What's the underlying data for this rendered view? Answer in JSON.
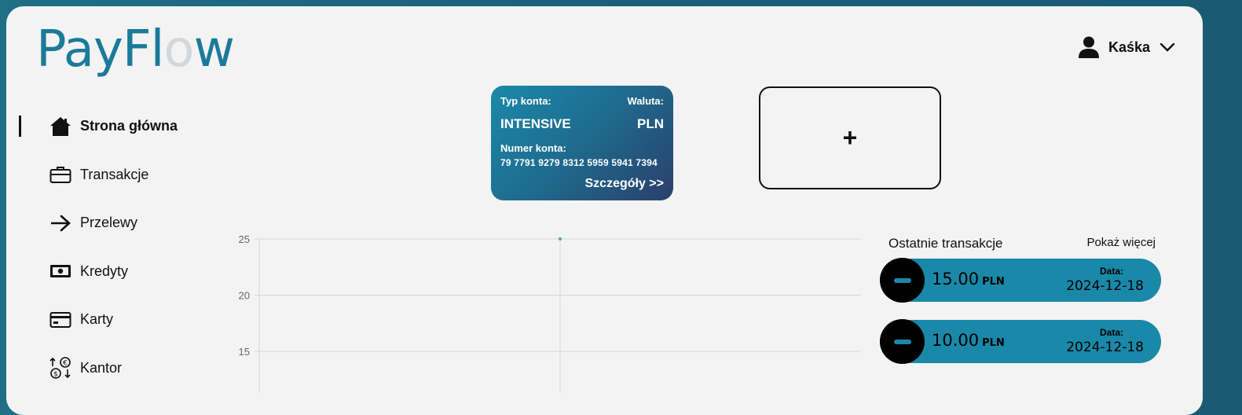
{
  "brand": {
    "name_prefix": "PayFl",
    "name_o": "o",
    "name_suffix": "w"
  },
  "user": {
    "name": "Kaśka"
  },
  "nav": [
    {
      "label": "Strona główna",
      "icon": "home-icon",
      "active": true
    },
    {
      "label": "Transakcje",
      "icon": "briefcase-icon",
      "active": false
    },
    {
      "label": "Przelewy",
      "icon": "arrow-right-icon",
      "active": false
    },
    {
      "label": "Kredyty",
      "icon": "cash-icon",
      "active": false
    },
    {
      "label": "Karty",
      "icon": "card-icon",
      "active": false
    },
    {
      "label": "Kantor",
      "icon": "exchange-icon",
      "active": false
    }
  ],
  "account": {
    "type_label": "Typ konta:",
    "type_value": "INTENSIVE",
    "currency_label": "Waluta:",
    "currency_value": "PLN",
    "number_label": "Numer konta:",
    "number_value": "79 7791 9279 8312 5959 5941 7394",
    "details_label": "Szczegóły >>"
  },
  "add_account": {
    "label": "+"
  },
  "chart_data": {
    "type": "line",
    "y_ticks": [
      "25",
      "20",
      "15"
    ],
    "ylim": [
      10,
      25
    ],
    "x": [
      ""
    ],
    "series": [
      {
        "values": [
          25
        ]
      }
    ],
    "grid": true
  },
  "transactions": {
    "title": "Ostatnie transakcje",
    "more_label": "Pokaż więcej",
    "date_label": "Data:",
    "items": [
      {
        "amount": "15.00",
        "currency": "PLN",
        "date": "2024-12-18"
      },
      {
        "amount": "10.00",
        "currency": "PLN",
        "date": "2024-12-18"
      }
    ]
  },
  "colors": {
    "accent": "#1a88a8",
    "brand": "#1b7a9a",
    "background": "#f3f3f3"
  }
}
